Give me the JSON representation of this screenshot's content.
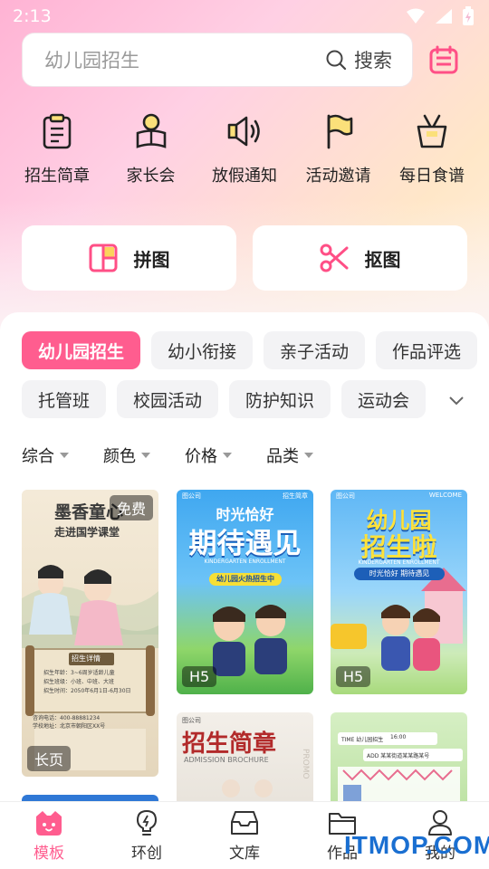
{
  "status": {
    "time": "2:13"
  },
  "search": {
    "placeholder": "幼儿园招生",
    "button_label": "搜索"
  },
  "quick_actions": [
    {
      "label": "招生简章",
      "icon": "clipboard-icon"
    },
    {
      "label": "家长会",
      "icon": "parent-reading-icon"
    },
    {
      "label": "放假通知",
      "icon": "speaker-icon"
    },
    {
      "label": "活动邀请",
      "icon": "flag-icon"
    },
    {
      "label": "每日食谱",
      "icon": "basket-icon"
    }
  ],
  "tools": [
    {
      "label": "拼图",
      "icon": "collage-icon"
    },
    {
      "label": "抠图",
      "icon": "scissors-icon"
    }
  ],
  "categories_row1": [
    "幼儿园招生",
    "幼小衔接",
    "亲子活动",
    "作品评选"
  ],
  "categories_row2": [
    "托管班",
    "校园活动",
    "防护知识",
    "运动会"
  ],
  "active_category": "幼儿园招生",
  "filters": [
    "综合",
    "颜色",
    "价格",
    "品类"
  ],
  "cards": {
    "card1": {
      "badge_top": "免费",
      "badge_bottom": "长页",
      "title_lines": [
        "墨香童心",
        "走进国学课堂"
      ],
      "scroll_title": "招生详情",
      "info_lines": [
        "招生年龄：3~6周岁适龄儿童",
        "招生班级：小班、中班、大班",
        "招生时间：2050年6月1日-6月30日"
      ],
      "contact_lines": [
        "咨询电话：400-88881234",
        "学校地址：北京市朝阳区XX号"
      ]
    },
    "card2": {
      "brand": "图公司",
      "corner_tag": "招生简章",
      "title_top": "时光恰好",
      "title_main": "期待遇见",
      "subtitle": "KINDERGARTEN ENROLLMENT",
      "ribbon": "幼儿园火热招生中",
      "badge": "H5"
    },
    "card3": {
      "brand": "图公司",
      "corner_tag": "WELCOME",
      "title_top": "幼儿园",
      "title_main": "招生啦",
      "subtitle": "KINDERGARTEN ENROLLMENT",
      "ribbon": "时光恰好 期待遇见",
      "badge": "H5"
    },
    "card4": {
      "brand": "图公司",
      "title": "招生简章",
      "subtitle": "ADMISSION BROCHURE",
      "side_text": "PROMO"
    },
    "card5": {
      "line1": "TIME 幼儿园招生",
      "line2": "ADD 某某街道某某路某号",
      "time": "16:00"
    }
  },
  "tabs": [
    {
      "label": "模板",
      "icon": "cat-face-icon",
      "active": true
    },
    {
      "label": "环创",
      "icon": "lightbulb-icon",
      "active": false
    },
    {
      "label": "文库",
      "icon": "inbox-icon",
      "active": false
    },
    {
      "label": "作品",
      "icon": "folder-icon",
      "active": false
    },
    {
      "label": "我的",
      "icon": "person-icon",
      "active": false
    }
  ],
  "watermark": "ITMOP.COM",
  "colors": {
    "accent": "#ff5d8f",
    "hero_pink": "#ffb3d4",
    "hero_peach": "#ffe7c8"
  }
}
